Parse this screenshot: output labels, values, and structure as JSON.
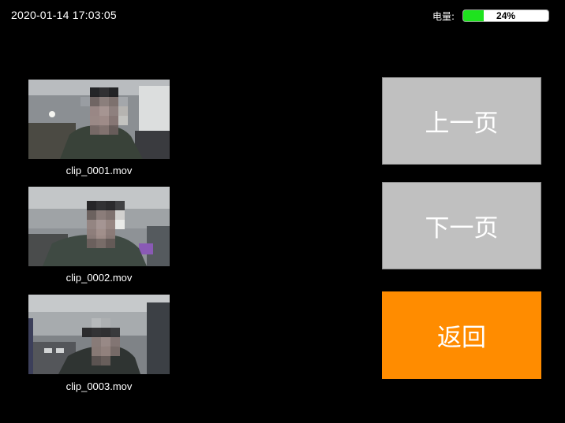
{
  "status_bar": {
    "datetime": "2020-01-14 17:03:05",
    "battery_label": "电量:",
    "battery_percent_text": "24%",
    "battery_level": 0.24,
    "battery_fill_color": "#1ee31e"
  },
  "clips": [
    {
      "name": "clip_0001.mov"
    },
    {
      "name": "clip_0002.mov"
    },
    {
      "name": "clip_0003.mov"
    }
  ],
  "buttons": {
    "prev_page": "上一页",
    "next_page": "下一页",
    "back": "返回"
  },
  "colors": {
    "background": "#000000",
    "button_grey": "#c0c0c0",
    "button_orange": "#ff8c00"
  }
}
